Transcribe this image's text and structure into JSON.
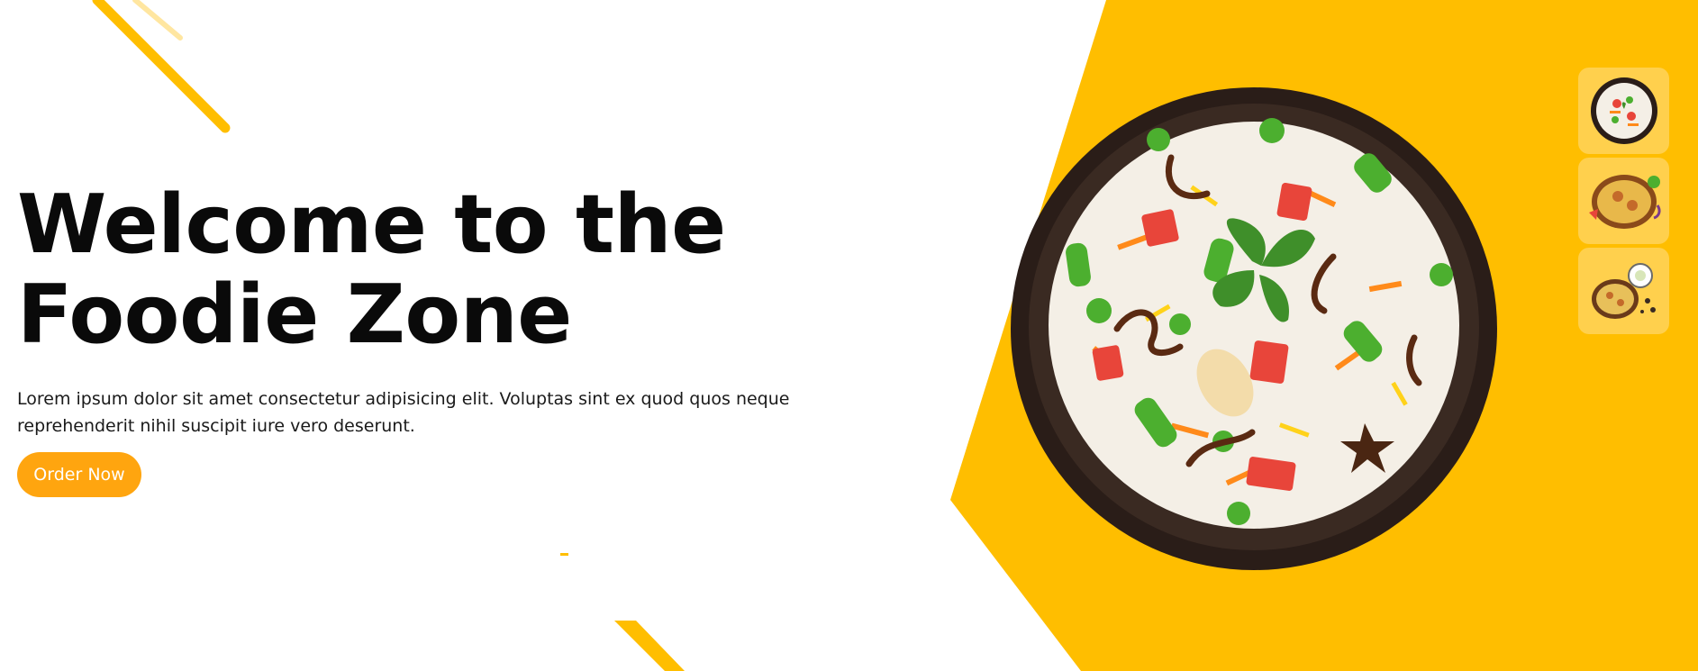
{
  "hero": {
    "title_line1": "Welcome to the",
    "title_line2": "Foodie Zone",
    "description": "Lorem ipsum dolor sit amet consectetur adipisicing elit. Voluptas sint ex quod quos neque reprehenderit nihil suscipit iure vero deserunt.",
    "cta_label": "Order Now"
  },
  "colors": {
    "accent": "#ffbe00",
    "button": "#ffa50f",
    "thumb_bg": "#ffd04d"
  },
  "thumbnails": [
    {
      "icon": "veg-biryani-plate-icon"
    },
    {
      "icon": "chicken-biryani-plate-icon"
    },
    {
      "icon": "biryani-with-raita-icon"
    }
  ]
}
